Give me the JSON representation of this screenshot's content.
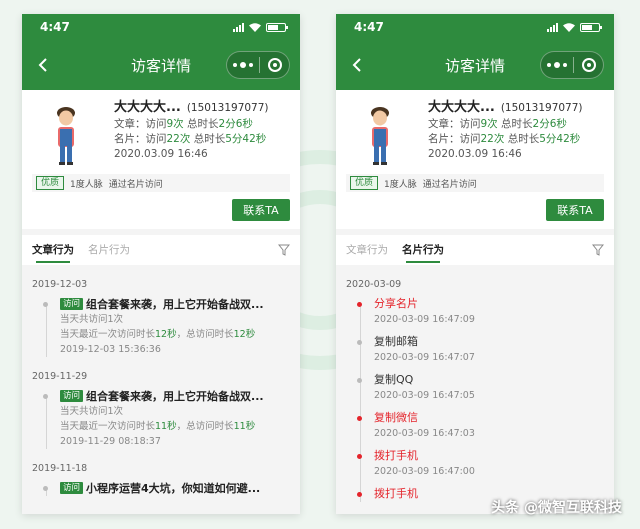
{
  "status": {
    "time": "4:47"
  },
  "nav": {
    "title": "访客详情"
  },
  "visitor": {
    "name": "大大大大...",
    "phone": "(15013197077)",
    "article_prefix": "文章：访问",
    "article_visits": "9次",
    "article_dur_label": " 总时长",
    "article_duration": "2分6秒",
    "card_prefix": "名片：访问",
    "card_visits": "22次",
    "card_dur_label": " 总时长",
    "card_duration": "5分42秒",
    "date": "2020.03.09 16:46",
    "tag": "优质",
    "contacts": "1度人脉",
    "source": "通过名片访问",
    "contact_button": "联系TA"
  },
  "tabs": [
    "文章行为",
    "名片行为"
  ],
  "left_timeline": [
    {
      "date": "2019-12-03",
      "items": [
        {
          "tag": "访问",
          "title": "组合套餐来袭，用上它开始备战双...",
          "line1": "当天共访问1次",
          "line2_prefix": "当天最近一次访问时长",
          "line2_v1": "12秒",
          "line2_mid": "，总访问时长",
          "line2_v2": "12秒",
          "time": "2019-12-03 15:36:36"
        }
      ]
    },
    {
      "date": "2019-11-29",
      "items": [
        {
          "tag": "访问",
          "title": "组合套餐来袭，用上它开始备战双...",
          "line1": "当天共访问1次",
          "line2_prefix": "当天最近一次访问时长",
          "line2_v1": "11秒",
          "line2_mid": "，总访问时长",
          "line2_v2": "11秒",
          "time": "2019-11-29 08:18:37"
        }
      ]
    },
    {
      "date": "2019-11-18",
      "items": [
        {
          "tag": "访问",
          "title": "小程序运营4大坑，你知道如何避...",
          "line1": "",
          "line2_prefix": "",
          "line2_v1": "",
          "line2_mid": "",
          "line2_v2": "",
          "time": ""
        }
      ]
    }
  ],
  "right_timeline": {
    "date": "2020-03-09",
    "items": [
      {
        "action": "分享名片",
        "time": "2020-03-09 16:47:09",
        "highlight": true
      },
      {
        "action": "复制邮箱",
        "time": "2020-03-09 16:47:07",
        "highlight": false
      },
      {
        "action": "复制QQ",
        "time": "2020-03-09 16:47:05",
        "highlight": false
      },
      {
        "action": "复制微信",
        "time": "2020-03-09 16:47:03",
        "highlight": true
      },
      {
        "action": "拨打手机",
        "time": "2020-03-09 16:47:00",
        "highlight": true
      },
      {
        "action": "拨打手机",
        "time": "",
        "highlight": true
      }
    ]
  },
  "watermark": "头条 @微智互联科技",
  "colors": {
    "brand": "#2e8b3e",
    "alert": "#e4242b"
  }
}
